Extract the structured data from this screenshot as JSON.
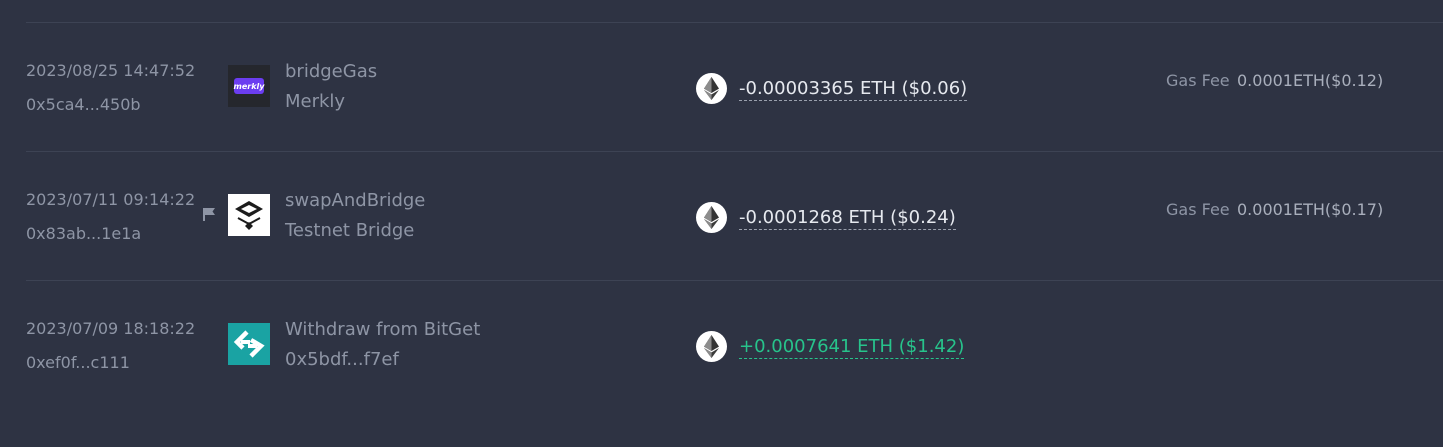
{
  "transactions": [
    {
      "time": "2023/08/25 14:47:52",
      "hash": "0x5ca4...450b",
      "action": "bridgeGas",
      "target": "Merkly",
      "logo": "merkly-logo",
      "logo_text": "merkly",
      "flagged": false,
      "amount": "-0.00003365 ETH ($0.06)",
      "direction": "out",
      "fee_label": "Gas Fee",
      "fee_value": "0.0001ETH($0.12)"
    },
    {
      "time": "2023/07/11 09:14:22",
      "hash": "0x83ab...1e1a",
      "action": "swapAndBridge",
      "target": "Testnet Bridge",
      "logo": "testnet-bridge-logo",
      "flagged": true,
      "amount": "-0.0001268 ETH ($0.24)",
      "direction": "out",
      "fee_label": "Gas Fee",
      "fee_value": "0.0001ETH($0.17)"
    },
    {
      "time": "2023/07/09 18:18:22",
      "hash": "0xef0f...c111",
      "action": "Withdraw from BitGet",
      "target": "0x5bdf...f7ef",
      "logo": "bitget-logo",
      "flagged": false,
      "amount": "+0.0007641 ETH ($1.42)",
      "direction": "in"
    }
  ],
  "colors": {
    "background": "#2e3343",
    "divider": "#3d4354",
    "muted_text": "#8e95a5",
    "amount_out": "#e6e9ef",
    "amount_in": "#27c38b",
    "bitget_teal": "#1aa3a3"
  },
  "icons": {
    "token": "ethereum-icon",
    "flag": "flag-icon"
  }
}
